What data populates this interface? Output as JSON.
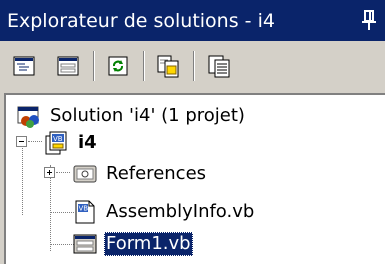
{
  "window": {
    "title": "Explorateur de solutions - i4",
    "pin_icon": "pushpin-icon"
  },
  "toolbar": {
    "buttons": [
      {
        "icon": "view-code-icon"
      },
      {
        "icon": "view-designer-icon"
      },
      {
        "icon": "refresh-icon"
      },
      {
        "icon": "show-all-files-icon"
      },
      {
        "icon": "properties-icon"
      }
    ]
  },
  "tree": {
    "solution": {
      "label": "Solution 'i4' (1 projet)",
      "icon": "solution-icon"
    },
    "project": {
      "label": "i4",
      "icon": "vb-project-icon",
      "expanded": true
    },
    "items": [
      {
        "label": "References",
        "icon": "references-icon",
        "expandable": true,
        "expanded": false
      },
      {
        "label": "AssemblyInfo.vb",
        "icon": "vb-file-icon",
        "expandable": false
      },
      {
        "label": "Form1.vb",
        "icon": "form-icon",
        "expandable": false,
        "selected": true
      }
    ]
  },
  "colors": {
    "title_bar": "#0a246a",
    "panel": "#d4d0c8",
    "tree_background": "#ffffff",
    "selection": "#0a246a"
  }
}
